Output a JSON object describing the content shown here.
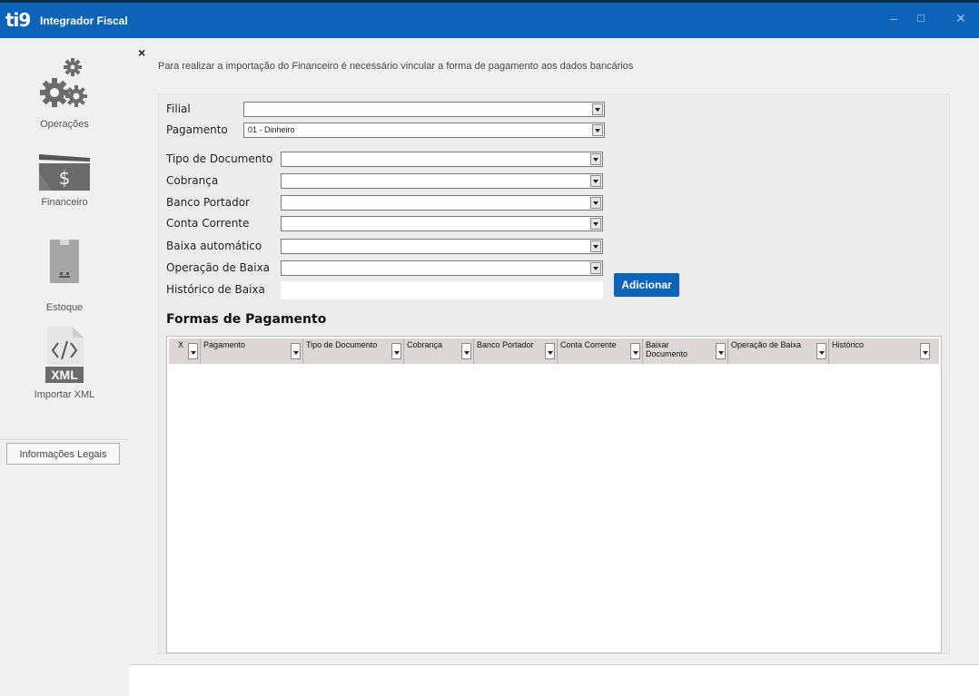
{
  "window": {
    "logo": "ti9",
    "title": "Integrador Fiscal",
    "buttons": {
      "minimize": "–",
      "maximize": "☐",
      "close": "✕"
    }
  },
  "sidebar": {
    "items": [
      {
        "label": "Operações",
        "icon": "gears-icon"
      },
      {
        "label": "Financeiro",
        "icon": "money-icon"
      },
      {
        "label": "Estoque",
        "icon": "box-icon"
      },
      {
        "label": "Importar XML",
        "icon": "xml-icon",
        "badge": "XML"
      }
    ],
    "legal_button": "Informações Legais"
  },
  "main": {
    "close_label": "×",
    "info": "Para realizar a importação do Financeiro é necessário vincular a forma de pagamento aos dados bancários",
    "fields": {
      "filial": {
        "label": "Filial",
        "value": ""
      },
      "pagamento": {
        "label": "Pagamento",
        "value": "01 - Dinheiro"
      },
      "tipo_documento": {
        "label": "Tipo de Documento",
        "value": ""
      },
      "cobranca": {
        "label": "Cobrança",
        "value": ""
      },
      "banco_portador": {
        "label": "Banco Portador",
        "value": ""
      },
      "conta_corrente": {
        "label": "Conta Corrente",
        "value": ""
      },
      "baixa_automatico": {
        "label": "Baixa automático",
        "value": ""
      },
      "operacao_baixa": {
        "label": "Operação de Baixa",
        "value": ""
      },
      "historico_baixa": {
        "label": "Histórico de Baixa",
        "value": ""
      }
    },
    "add_button": "Adicionar",
    "section_title": "Formas de Pagamento",
    "grid": {
      "columns": [
        "X",
        "Pagamento",
        "Tipo de Documento",
        "Cobrança",
        "Banco Portador",
        "Conta Corrente",
        "Baixar Documento",
        "Operação de Baixa",
        "Histórico"
      ],
      "rows": []
    }
  },
  "colors": {
    "accent": "#0d63b8",
    "titlebar": "#0d63b8",
    "header": "#ddd6d6"
  }
}
